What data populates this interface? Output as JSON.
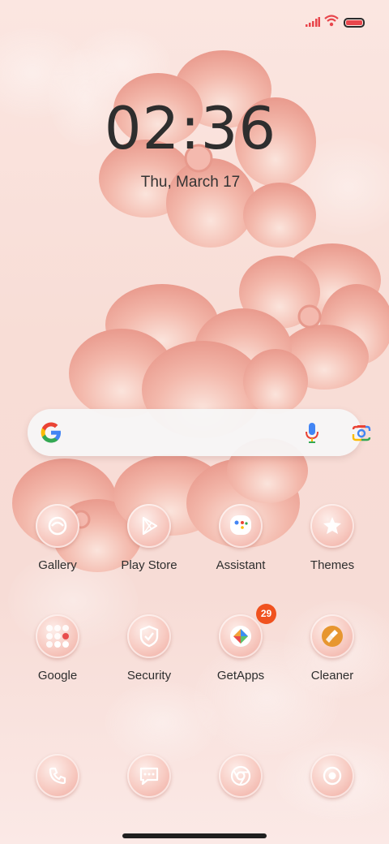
{
  "status_bar": {
    "icons": [
      "cellular-signal-icon",
      "wifi-icon",
      "battery-icon"
    ],
    "battery_color": "#e8464c"
  },
  "clock": {
    "time": "02:36",
    "date": "Thu, March 17"
  },
  "search": {
    "icons": [
      "google-g-icon",
      "microphone-icon",
      "google-lens-icon"
    ]
  },
  "apps": [
    {
      "label": "Gallery",
      "icon": "gallery-icon"
    },
    {
      "label": "Play Store",
      "icon": "play-store-icon"
    },
    {
      "label": "Assistant",
      "icon": "assistant-icon"
    },
    {
      "label": "Themes",
      "icon": "themes-icon"
    },
    {
      "label": "Google",
      "icon": "google-folder-icon"
    },
    {
      "label": "Security",
      "icon": "security-shield-icon"
    },
    {
      "label": "GetApps",
      "icon": "getapps-icon",
      "badge": "29"
    },
    {
      "label": "Cleaner",
      "icon": "cleaner-brush-icon"
    }
  ],
  "dock": [
    {
      "icon": "phone-icon"
    },
    {
      "icon": "messages-icon"
    },
    {
      "icon": "chrome-icon"
    },
    {
      "icon": "camera-icon"
    }
  ],
  "colors": {
    "background": "#f8ddd6",
    "icon_rim": "#eea79d",
    "badge": "#f0521f",
    "text": "#2e2e2e"
  }
}
